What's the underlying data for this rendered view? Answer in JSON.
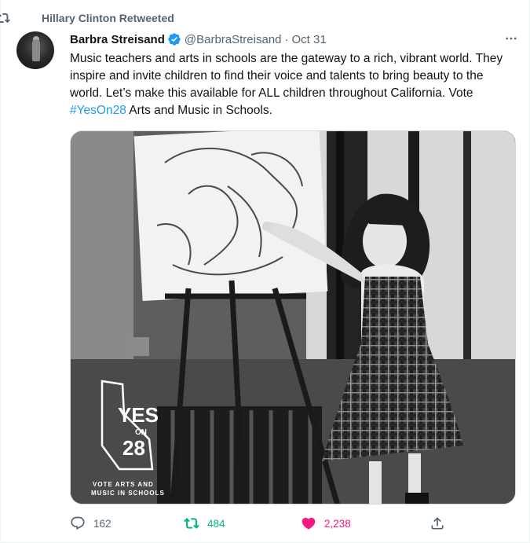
{
  "retweet_context": {
    "label": "Hillary Clinton Retweeted"
  },
  "author": {
    "name": "Barbra Streisand",
    "handle": "@BarbraStreisand",
    "separator": "·",
    "time": "Oct 31"
  },
  "tweet": {
    "text_before": "Music teachers and arts in schools are the gateway to a rich, vibrant world. They inspire and invite children to find their voice and talents to bring beauty to the world. Let’s make this available for ALL children throughout California. Vote ",
    "hashtag": "#YesOn28",
    "text_after": " Arts and Music in Schools."
  },
  "media": {
    "logo_yes": "YES",
    "logo_on": "ON",
    "logo_num": "28",
    "logo_caption_1": "VOTE ARTS AND",
    "logo_caption_2": "MUSIC IN SCHOOLS"
  },
  "actions": {
    "replies": "162",
    "retweets": "484",
    "likes": "2,238"
  },
  "colors": {
    "accent": "#1d9bf0",
    "retweet": "#00ba7c",
    "like": "#f91880",
    "secondary_text": "#536471"
  },
  "icons": {
    "retweet": "retweet-icon",
    "verified": "verified-badge-icon",
    "more": "more-icon",
    "reply": "reply-icon",
    "like": "heart-icon",
    "share": "share-icon"
  }
}
